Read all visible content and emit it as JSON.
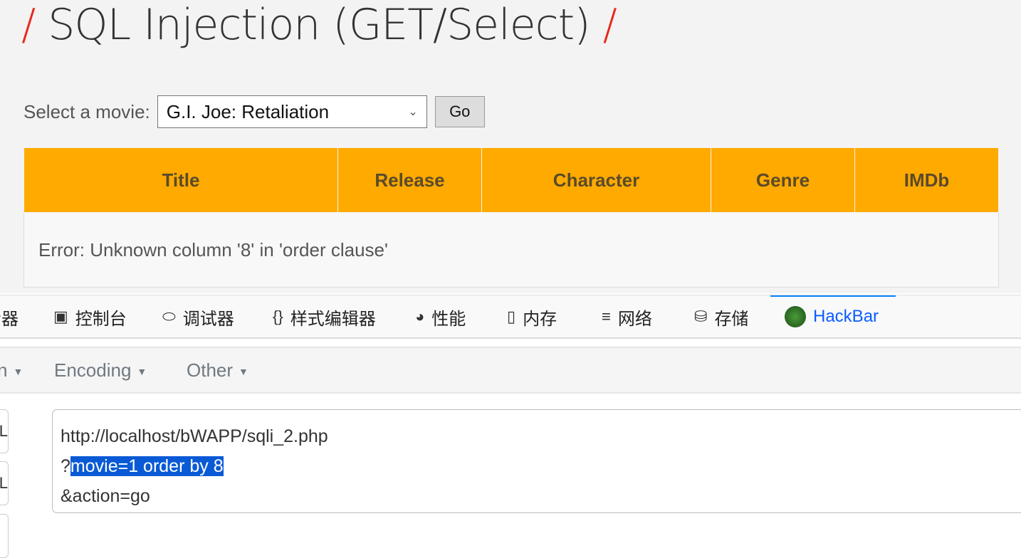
{
  "page": {
    "title": "SQL Injection (GET/Select)",
    "slash": "/",
    "select_label": "Select a movie:",
    "selected_movie": "G.I. Joe: Retaliation",
    "go_label": "Go",
    "table": {
      "headers": [
        "Title",
        "Release",
        "Character",
        "Genre",
        "IMDb"
      ],
      "error": "Error: Unknown column '8' in 'order clause'"
    },
    "colors": {
      "header": "#ffaa00",
      "accent": "#e8281c"
    }
  },
  "devtools": {
    "tabs": [
      {
        "label": "查看器",
        "visible": "器",
        "icon": "inspector-icon"
      },
      {
        "label": "控制台",
        "icon": "console-icon"
      },
      {
        "label": "调试器",
        "icon": "debugger-icon"
      },
      {
        "label": "样式编辑器",
        "icon": "braces-icon"
      },
      {
        "label": "性能",
        "icon": "performance-icon"
      },
      {
        "label": "内存",
        "icon": "memory-icon"
      },
      {
        "label": "网络",
        "icon": "network-icon"
      },
      {
        "label": "存储",
        "icon": "storage-icon"
      },
      {
        "label": "HackBar",
        "icon": "hackbar-icon",
        "active": true
      }
    ]
  },
  "hackbar": {
    "menus": [
      "n",
      "Encoding",
      "Other"
    ],
    "buttons": [
      "RL",
      "RL"
    ],
    "url_lines": {
      "l1": "http://localhost/bWAPP/sqli_2.php",
      "l2_pre": "?",
      "l2_sel": "movie=1 order by 8",
      "l3": "&action=go"
    }
  }
}
